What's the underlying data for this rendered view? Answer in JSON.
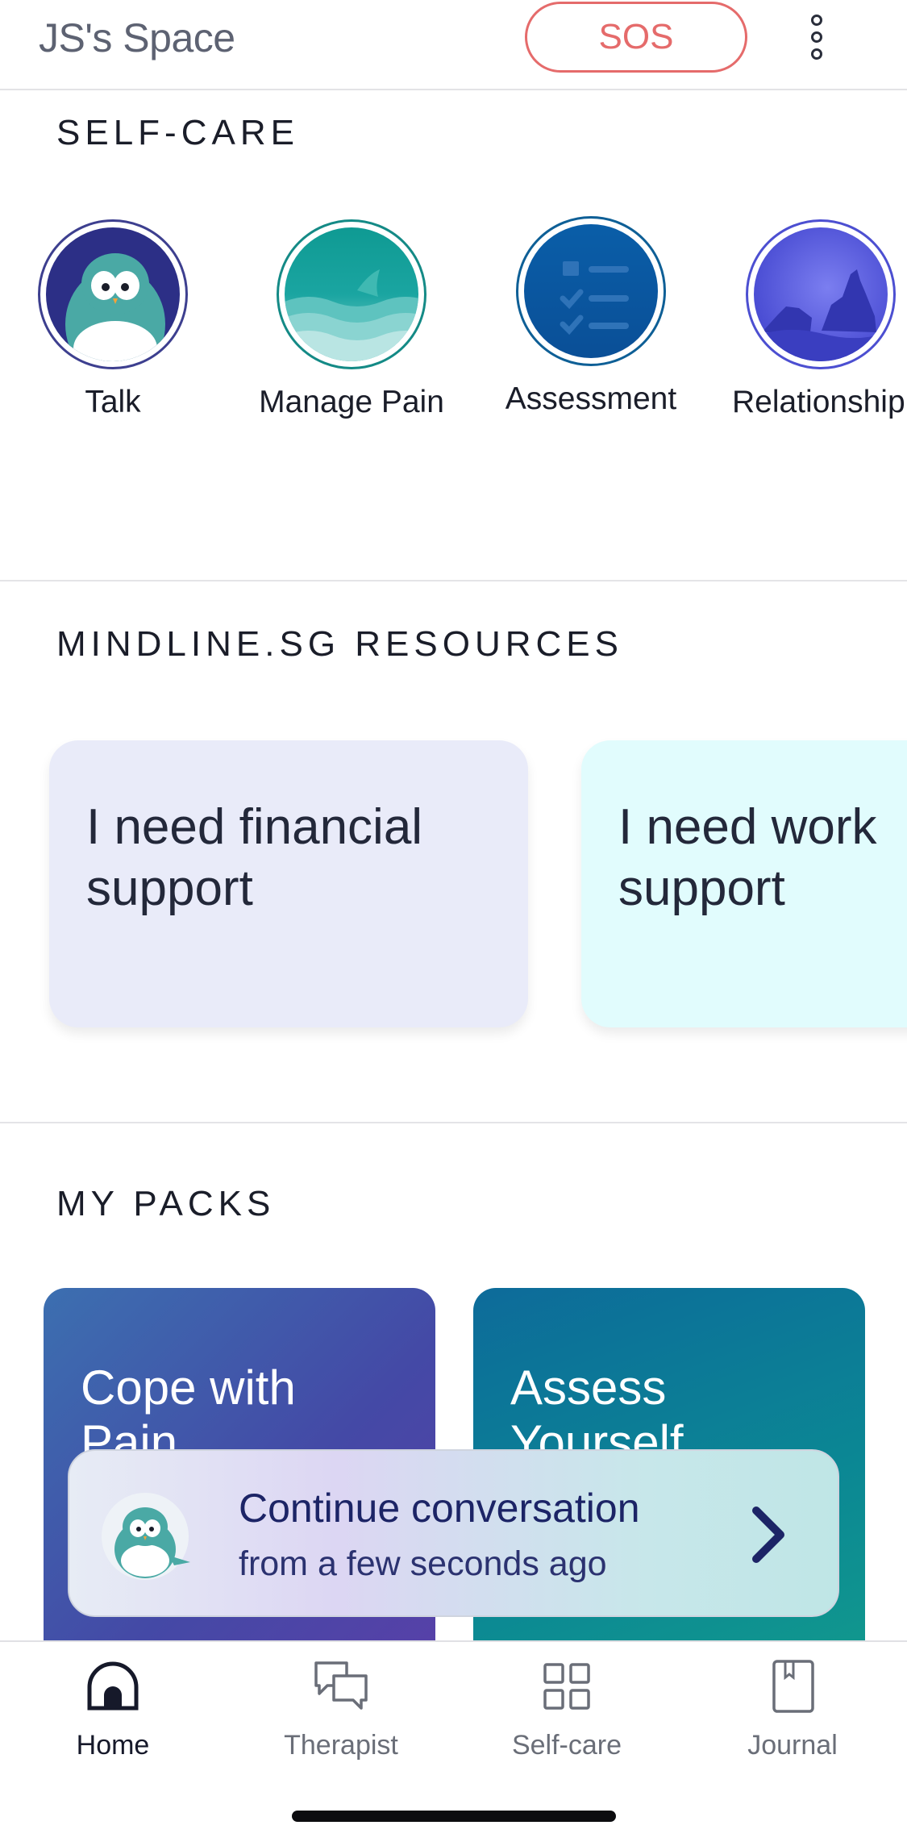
{
  "header": {
    "title": "JS's Space",
    "sos_label": "SOS",
    "more_icon": "more-vertical-icon"
  },
  "self_care": {
    "section_title": "SELF-CARE",
    "items": [
      {
        "label": "Talk",
        "icon": "penguin-icon"
      },
      {
        "label": "Manage Pain",
        "icon": "shark-fin-icon"
      },
      {
        "label": "Assessment",
        "icon": "checklist-icon"
      },
      {
        "label": "Relationship",
        "icon": "wolves-icon"
      }
    ]
  },
  "resources": {
    "section_title": "MINDLINE.SG RESOURCES",
    "cards": [
      {
        "label": "I need financial support",
        "color": "#e9ebf9"
      },
      {
        "label": "I need work support",
        "color": "#e1fcfd"
      }
    ]
  },
  "packs": {
    "section_title": "MY PACKS",
    "items": [
      {
        "label": "Cope with Pain"
      },
      {
        "label": "Assess Yourself"
      }
    ]
  },
  "continue_banner": {
    "title": "Continue conversation",
    "subtitle": "from a few seconds ago"
  },
  "nav": {
    "items": [
      {
        "label": "Home",
        "icon": "home-icon",
        "active": true
      },
      {
        "label": "Therapist",
        "icon": "chat-bubbles-icon",
        "active": false
      },
      {
        "label": "Self-care",
        "icon": "grid-icon",
        "active": false
      },
      {
        "label": "Journal",
        "icon": "journal-icon",
        "active": false
      }
    ]
  },
  "colors": {
    "sos": "#e56b6b",
    "accent_navy": "#1c2466",
    "teal": "#0a8a8f"
  }
}
